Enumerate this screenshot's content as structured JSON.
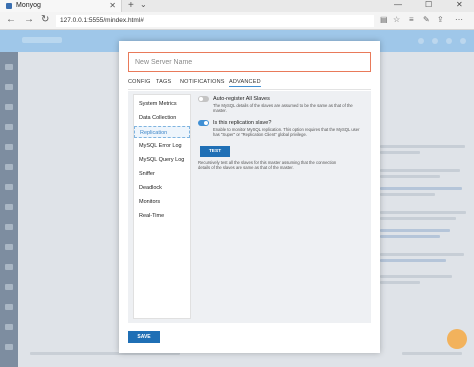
{
  "browser": {
    "tab_title": "Monyog",
    "tab_close": "✕",
    "new_tab": "+",
    "tab_list": "⌄",
    "url": "127.0.0.1:5555/mindex.html#",
    "window": {
      "minimize": "—",
      "maximize": "☐",
      "close": "✕"
    },
    "icons": [
      "back-icon",
      "forward-icon",
      "refresh-icon",
      "reading-view-icon",
      "favorite-icon",
      "favorites-hub-icon",
      "notes-icon",
      "share-icon",
      "more-icon"
    ]
  },
  "modal": {
    "server_name_placeholder": "New Server Name",
    "tabs": [
      {
        "label": "CONFIG"
      },
      {
        "label": "TAGS"
      },
      {
        "label": "NOTIFICATIONS"
      },
      {
        "label": "ADVANCED",
        "active": true
      }
    ],
    "advanced_menu": [
      {
        "label": "System Metrics"
      },
      {
        "label": "Data Collection"
      },
      {
        "label": "Replication",
        "active": true
      },
      {
        "label": "MySQL Error Log"
      },
      {
        "label": "MySQL Query Log"
      },
      {
        "label": "Sniffer"
      },
      {
        "label": "Deadlock"
      },
      {
        "label": "Monitors"
      },
      {
        "label": "Real-Time"
      }
    ],
    "replication": {
      "auto_register": {
        "title": "Auto-register All Slaves",
        "description": "The MySQL details of the slaves are assumed to be the same as that of the master.",
        "enabled": false
      },
      "is_slave": {
        "title": "Is this replication slave?",
        "description": "Enable to monitor MySQL replication. This option requires that the MySQL user has \"Super\" or \"Replication Client\" global privilege.",
        "enabled": true
      },
      "test_button": "TEST",
      "test_description": "Recursively test all the slaves for this master assuming that the connection details of the slaves are same as that of the master."
    },
    "save_button": "SAVE"
  },
  "colors": {
    "accent": "#3f8fd4",
    "button": "#1f6fb5",
    "input_border": "#e97a5a",
    "app_header": "#9fc7e9",
    "app_sidebar": "#7d8da0"
  }
}
